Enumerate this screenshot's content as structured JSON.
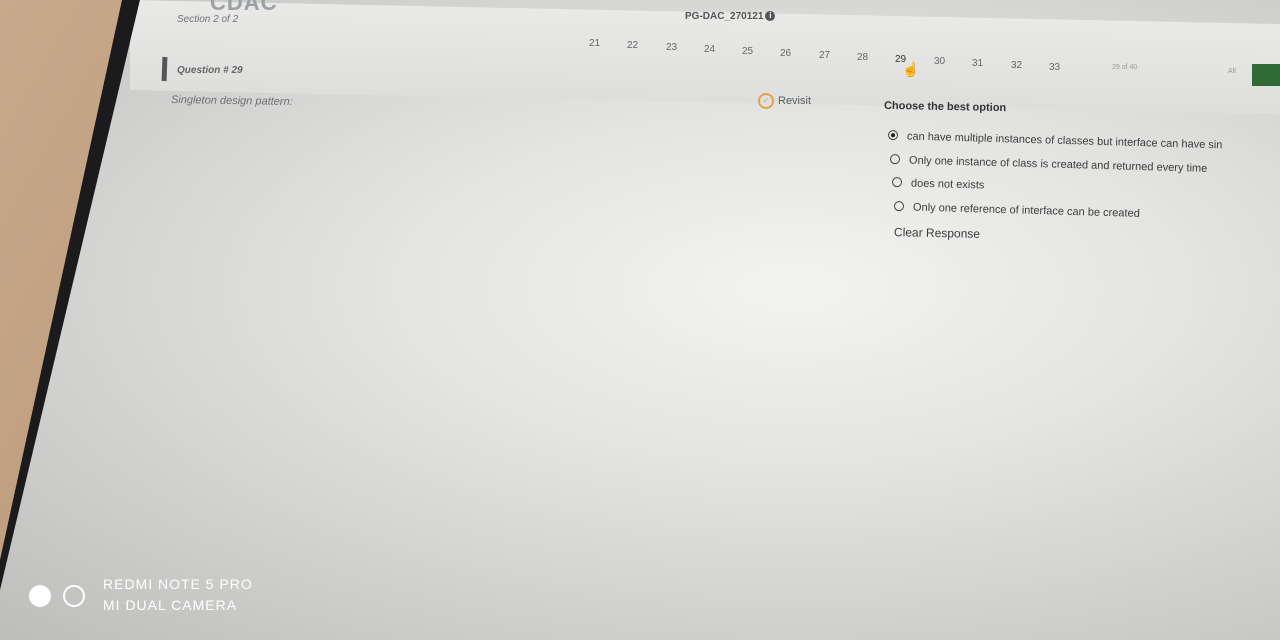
{
  "header": {
    "logo_text": "CDAC",
    "section_label": "Section 2 of 2",
    "exam_title": "PG-DAC_270121",
    "info_icon": "i"
  },
  "navigator": {
    "numbers": [
      "21",
      "22",
      "23",
      "24",
      "25",
      "26",
      "27",
      "28",
      "29",
      "30",
      "31",
      "32",
      "33"
    ],
    "current": "29",
    "counter": "29 of 40",
    "all_label": "All",
    "accent_color": "#2f6b35"
  },
  "question": {
    "label": "Question # 29",
    "text": "Singleton design pattern:",
    "revisit_label": "Revisit",
    "choose_label": "Choose the best option",
    "options": [
      {
        "text": "can have multiple instances of classes but interface can have sin",
        "selected": true
      },
      {
        "text": "Only one instance of class is created and returned every time",
        "selected": false
      },
      {
        "text": "does not exists",
        "selected": false
      },
      {
        "text": "Only one reference of interface can be created",
        "selected": false
      }
    ],
    "clear_label": "Clear Response"
  },
  "watermark": {
    "line1": "REDMI NOTE 5 PRO",
    "line2": "MI DUAL CAMERA"
  }
}
